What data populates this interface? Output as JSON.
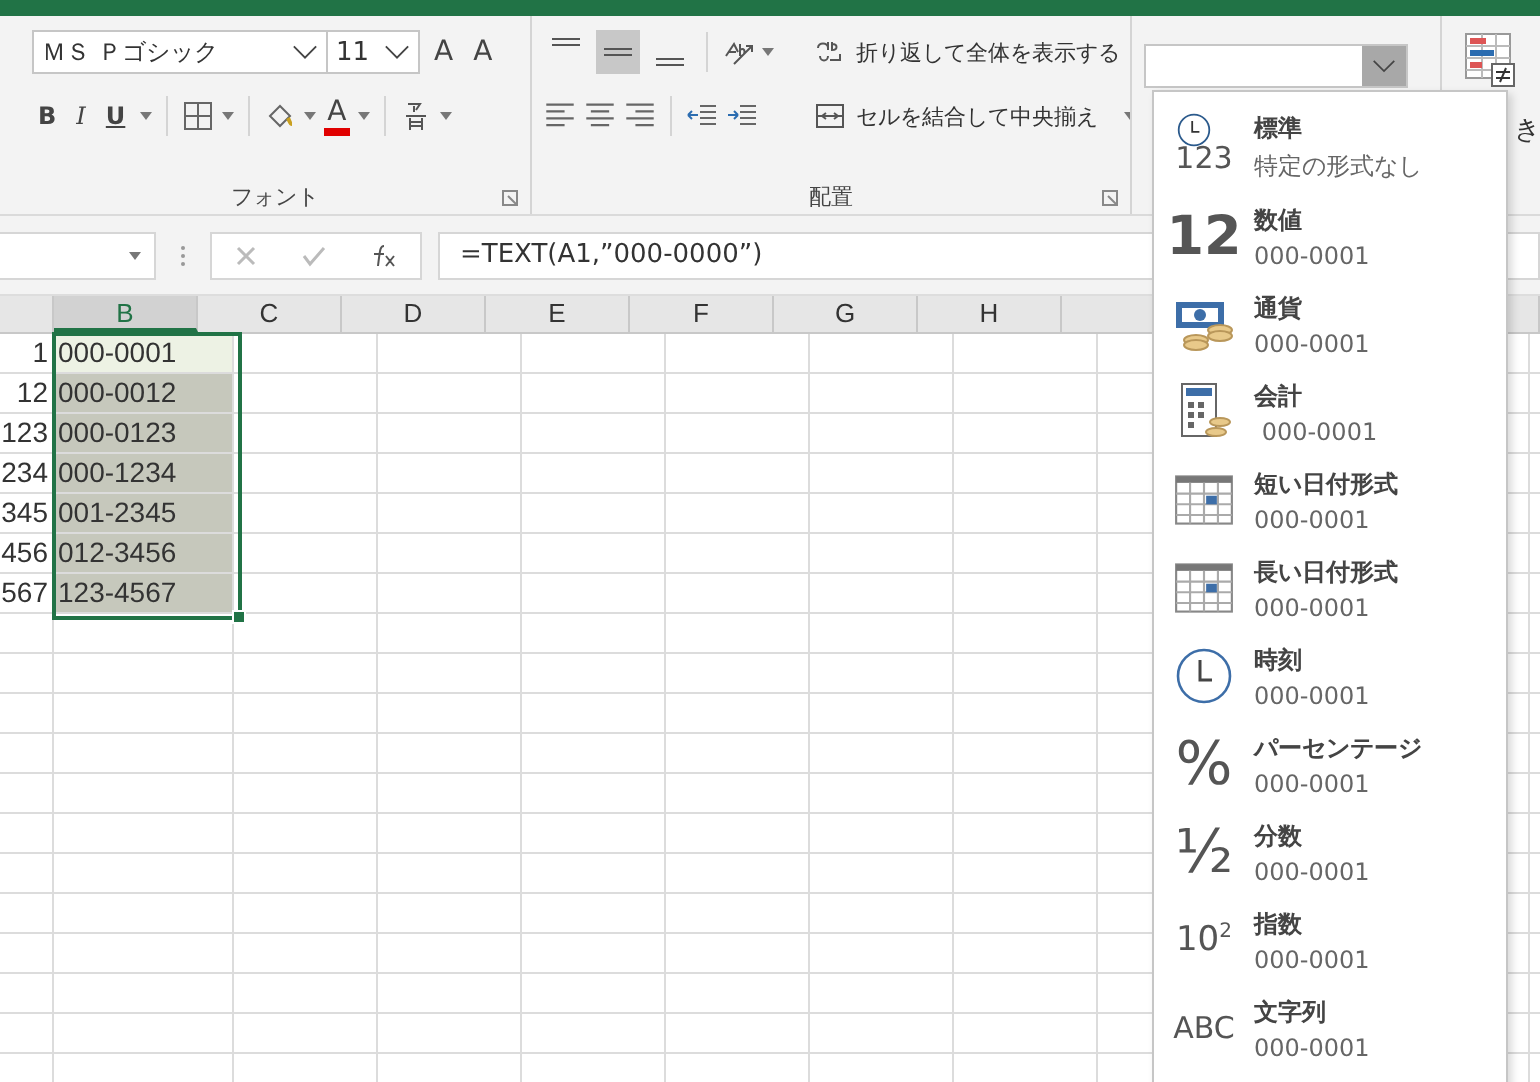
{
  "ribbon": {
    "font_group": {
      "label": "フォント",
      "font_name": "ＭＳ Ｐゴシック",
      "font_size": "11",
      "grow": "A",
      "shrink": "A",
      "bold": "B",
      "italic": "I",
      "underline": "U",
      "font_color": "A"
    },
    "alignment_group": {
      "label": "配置",
      "vertical_align": [
        {
          "selected": false
        },
        {
          "selected": true
        },
        {
          "selected": false
        }
      ],
      "wrap_text": "折り返して全体を表示する",
      "merge_center": "セルを結合して中央揃え"
    },
    "number_group": {
      "expanded": true
    },
    "styles_group": {
      "partial_label": "き"
    }
  },
  "formula_bar": {
    "formula": "=TEXT(A1,”000-0000”)"
  },
  "sheet": {
    "columns": [
      {
        "label": "B",
        "selected": true
      },
      {
        "label": "C",
        "selected": false
      },
      {
        "label": "D",
        "selected": false
      },
      {
        "label": "E",
        "selected": false
      },
      {
        "label": "F",
        "selected": false
      },
      {
        "label": "G",
        "selected": false
      },
      {
        "label": "H",
        "selected": false
      }
    ],
    "rows": [
      {
        "a": "1",
        "b": "000-0001",
        "active": true,
        "selected": true
      },
      {
        "a": "12",
        "b": "000-0012",
        "active": false,
        "selected": true
      },
      {
        "a": "123",
        "b": "000-0123",
        "active": false,
        "selected": true
      },
      {
        "a": "234",
        "b": "000-1234",
        "active": false,
        "selected": true
      },
      {
        "a": "345",
        "b": "001-2345",
        "active": false,
        "selected": true
      },
      {
        "a": "456",
        "b": "012-3456",
        "active": false,
        "selected": true
      },
      {
        "a": "567",
        "b": "123-4567",
        "active": false,
        "selected": true
      }
    ]
  },
  "format_menu": {
    "items": [
      {
        "kind": "general",
        "glyph": "123",
        "label": "標準",
        "sample": "特定の形式なし"
      },
      {
        "kind": "number",
        "glyph": "12",
        "label": "数値",
        "sample": "000-0001"
      },
      {
        "kind": "currency",
        "label": "通貨",
        "sample": "000-0001"
      },
      {
        "kind": "accounting",
        "label": "会計",
        "sample": " 000-0001"
      },
      {
        "kind": "short_date",
        "label": "短い日付形式",
        "sample": "000-0001"
      },
      {
        "kind": "long_date",
        "label": "長い日付形式",
        "sample": "000-0001"
      },
      {
        "kind": "time",
        "label": "時刻",
        "sample": "000-0001"
      },
      {
        "kind": "percent",
        "glyph": "%",
        "label": "パーセンテージ",
        "sample": "000-0001"
      },
      {
        "kind": "fraction",
        "glyph": "½",
        "label": "分数",
        "sample": "000-0001"
      },
      {
        "kind": "scientific",
        "glyph": "10$^{2}$",
        "label": "指数",
        "sample": "000-0001"
      },
      {
        "kind": "text",
        "glyph": "ABC",
        "label": "文字列",
        "sample": "000-0001"
      }
    ]
  }
}
